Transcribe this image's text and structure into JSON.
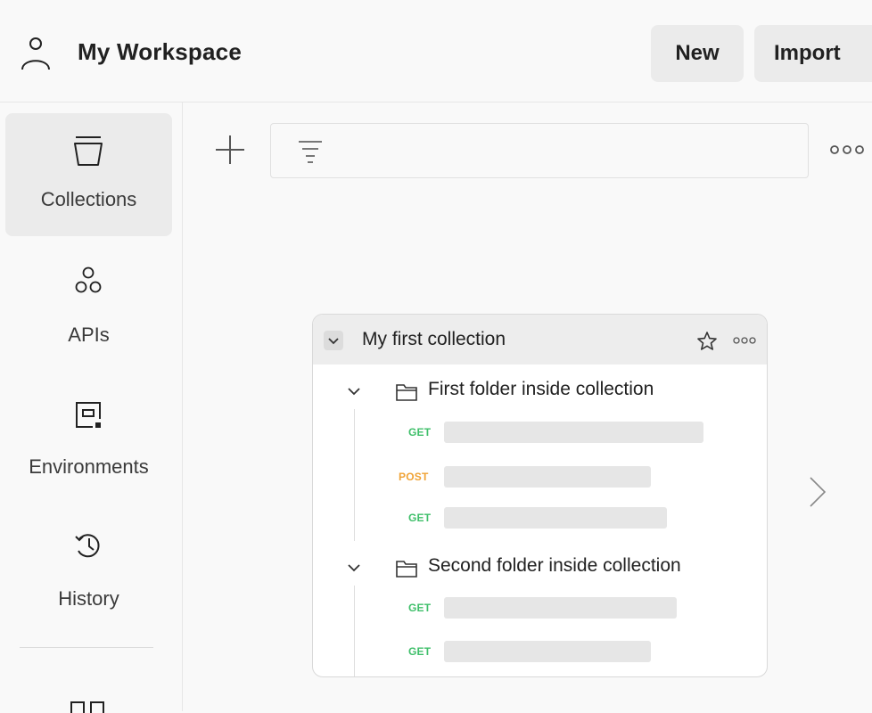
{
  "header": {
    "workspace_title": "My Workspace",
    "new_label": "New",
    "import_label": "Import"
  },
  "sidebar": {
    "items": [
      {
        "label": "Collections",
        "icon": "collections-icon",
        "active": true
      },
      {
        "label": "APIs",
        "icon": "apis-icon",
        "active": false
      },
      {
        "label": "Environments",
        "icon": "environments-icon",
        "active": false
      },
      {
        "label": "History",
        "icon": "history-icon",
        "active": false
      }
    ]
  },
  "toolbar": {
    "add_icon": "plus-icon",
    "filter_icon": "filter-icon",
    "more_icon": "more-icon"
  },
  "collection": {
    "name": "My first collection",
    "folders": [
      {
        "name": "First folder inside collection",
        "requests": [
          {
            "method": "GET"
          },
          {
            "method": "POST"
          },
          {
            "method": "GET"
          }
        ]
      },
      {
        "name": "Second folder inside collection",
        "requests": [
          {
            "method": "GET"
          },
          {
            "method": "GET"
          }
        ]
      }
    ]
  },
  "colors": {
    "get": "#3fbf6a",
    "post": "#f0a336",
    "active_bg": "#ebebeb"
  }
}
